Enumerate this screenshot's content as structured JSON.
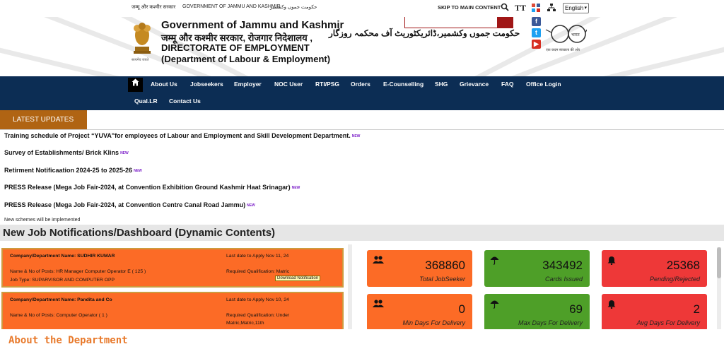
{
  "topbar": {
    "hindi": "जम्मू और कश्मीर सरकार",
    "gov": "GOVERNMENT OF JAMMU AND KASHMIR",
    "urdu": "حکومت جموں وکشمیر",
    "skip": "SKIP TO MAIN CONTENT",
    "font_size_label": "TT",
    "language": "English"
  },
  "header": {
    "title": "Government of Jammu and Kashmir",
    "hindi_line": "जम्मू और कश्मीर सरकार, रोजगार निदेशालय ,",
    "urdu_line": "حکومت جموں وکشمیر،ڈائریکٹوریٹ آف محکمہ روزگار",
    "directorate": "DIRECTORATE OF EMPLOYMENT",
    "department": "(Department of Labour & Employment)",
    "emblem_caption": "सत्यमेव जयते",
    "swachh_caption": "एक कदम स्वच्छता की ओर",
    "swachh_text": "भारत"
  },
  "nav": {
    "items": [
      "About Us",
      "Jobseekers",
      "Employer",
      "NOC User",
      "RTI/PSG",
      "Orders",
      "E-Counselling",
      "SHG",
      "Grievance",
      "FAQ",
      "Office Login",
      "Qual.LR",
      "Contact Us"
    ]
  },
  "updates": {
    "tab": "LATEST UPDATES",
    "new_badge": "NEW",
    "items": [
      "Training schedule of Project “YUVA\"for employees of Labour and Employment and Skill Development Department.",
      "Survey of Establishments/ Brick Klins",
      "Retirment Notificaation 2024-25 to 2025-26",
      "PRESS Release (Mega Job Fair-2024, at Convention Exhibition Ground Kashmir Haat Srinagar)",
      "PRESS Release (Mega Job Fair-2024, at Convention Centre Canal Road Jammu)"
    ],
    "footer": "New schemes will be implemented"
  },
  "notifications": {
    "title": "New Job Notifications/Dashboard (Dynamic Contents)",
    "jobs": [
      {
        "company": "Company/Department Name: SUDHIR KUMAR",
        "last_date": "Last date to Apply Nov 11, 24",
        "posts": "Name & No of Posts: HR Manager Computer Operator E ( 125 )",
        "qualification": "Required Qualification: Matric",
        "job_type": "Job Type: SUPARVISOR AND COMPUTER OPP",
        "download": "Download Notification"
      },
      {
        "company": "Company/Department Name: Pandita and Co",
        "last_date": "Last date to Apply Nov 10, 24",
        "posts": "Name & No of Posts: Computer Operator ( 1 )",
        "qualification": "Required Qualification: Under",
        "qualification2": "Matric,Matric,11th"
      }
    ]
  },
  "stats": [
    {
      "icon": "users-icon",
      "value": "368860",
      "label": "Total JobSeeker",
      "color": "#fc6b26"
    },
    {
      "icon": "umbrella-icon",
      "value": "343492",
      "label": "Cards Issued",
      "color": "#4e9f28"
    },
    {
      "icon": "bell-icon",
      "value": "25368",
      "label": "Pending/Rejected",
      "color": "#ee3838"
    },
    {
      "icon": "users-icon",
      "value": "0",
      "label": "Min Days For Delivery",
      "color": "#fc6b26"
    },
    {
      "icon": "umbrella-icon",
      "value": "69",
      "label": "Max Days For Delivery",
      "color": "#4e9f28"
    },
    {
      "icon": "bell-icon",
      "value": "2",
      "label": "Avg Days For Delivery",
      "color": "#ee3838"
    }
  ],
  "about": {
    "title": "About the Department"
  }
}
